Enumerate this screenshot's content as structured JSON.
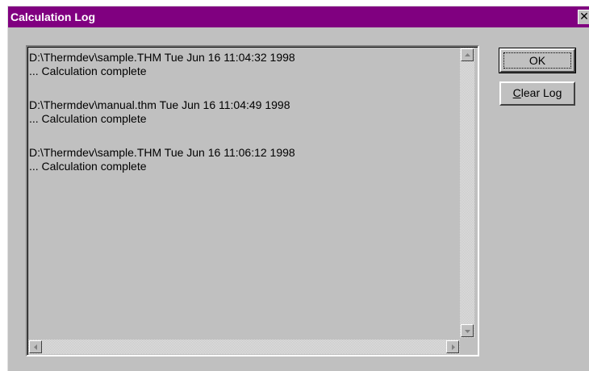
{
  "window": {
    "title": "Calculation Log",
    "close_glyph": "✕"
  },
  "log": {
    "entries": [
      {
        "header": "D:\\Thermdev\\sample.THM Tue Jun 16 11:04:32 1998",
        "status": "... Calculation complete"
      },
      {
        "header": "D:\\Thermdev\\manual.thm Tue Jun 16 11:04:49 1998",
        "status": "... Calculation complete"
      },
      {
        "header": "D:\\Thermdev\\sample.THM Tue Jun 16 11:06:12 1998",
        "status": "... Calculation complete"
      }
    ]
  },
  "buttons": {
    "ok_label": "OK",
    "clear_log_mnemonic": "C",
    "clear_log_rest": "lear Log"
  },
  "colors": {
    "titlebar": "#800080",
    "dialog_face": "#c0c0c0",
    "title_text": "#ffffff"
  },
  "icons": {
    "close": "close-icon",
    "up": "arrow-up-icon",
    "down": "arrow-down-icon",
    "left": "arrow-left-icon",
    "right": "arrow-right-icon"
  }
}
